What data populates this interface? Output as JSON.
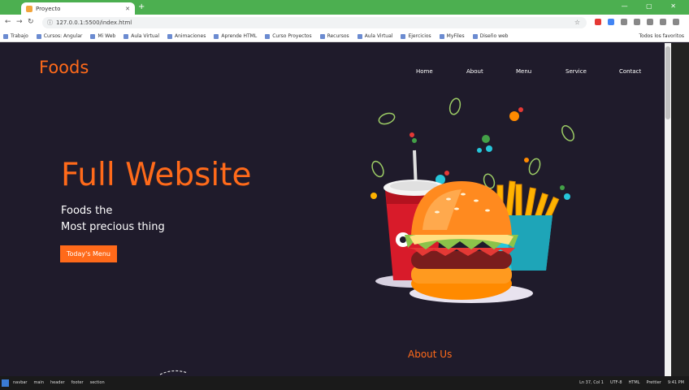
{
  "browser": {
    "tab_title": "Proyecto",
    "tab_close": "✕",
    "new_tab": "+",
    "window_controls": "— ▢ ✕",
    "url": "127.0.0.1:5500/index.html",
    "bookmarks": [
      "Trabajo",
      "Cursos: Angular",
      "Mi Web",
      "Aula Virtual",
      "Animaciones",
      "Aprende HTML",
      "Curso Proyectos",
      "Recursos",
      "Aula Virtual",
      "Ejercicios",
      "MyFiles",
      "Diseño web"
    ],
    "bookmarks_right": "Todos los favoritos"
  },
  "site": {
    "logo": "Foods",
    "nav": [
      "Home",
      "About",
      "Menu",
      "Service",
      "Contact"
    ],
    "hero_title": "Full Website",
    "hero_line1": "Foods the",
    "hero_line2": "Most precious thing",
    "hero_button": "Today's Menu",
    "about_heading": "About Us"
  },
  "taskbar": {
    "items": [
      "navbar",
      "main",
      "header",
      "footer",
      "section"
    ],
    "right": [
      "Ln 37, Col 1",
      "UTF-8",
      "HTML",
      "Prettier",
      "9:41 PM"
    ]
  },
  "colors": {
    "accent": "#ff6a1a",
    "background": "#1f1b2b",
    "chrome_green": "#4caf50"
  }
}
